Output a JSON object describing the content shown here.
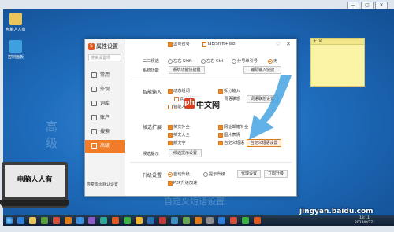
{
  "vm": {
    "title_buttons": [
      "—",
      "▢",
      "✕"
    ]
  },
  "desktop": {
    "icons": [
      {
        "label": "电脑人人有",
        "color": "#e8c45a"
      },
      {
        "label": "控制面板",
        "color": "#3fa0e0"
      }
    ],
    "watermark_big": [
      "高",
      "级"
    ],
    "watermark_bottom": "自定义短语设置",
    "laptop_label": "电脑人人有",
    "sticky_controls": "+ ✕"
  },
  "dialog": {
    "title": "属性设置",
    "search_placeholder": "搜索设置项",
    "win_buttons": {
      "skin": "♡",
      "close": "✕"
    },
    "nav": [
      {
        "label": "常用",
        "active": false
      },
      {
        "label": "外观",
        "active": false
      },
      {
        "label": "词库",
        "active": false
      },
      {
        "label": "账户",
        "active": false
      },
      {
        "label": "搜索",
        "active": false
      },
      {
        "label": "高级",
        "active": true
      }
    ],
    "restore_default": "恢复本页默认设置",
    "top_rows": {
      "row1": {
        "opt1": "逗号句号",
        "opt2": "Tab/Shift+Tab"
      },
      "row2": {
        "label": "二三候选",
        "opt1": "左右 Shift",
        "opt2": "左右 Ctrl",
        "opt3": "分号单引号",
        "opt4": "无"
      },
      "row3": {
        "label": "系统功能",
        "btn1": "系统功能快捷键",
        "btn2": "辅助输入快捷"
      }
    },
    "sections": {
      "fuzzy": {
        "title": "智能输入",
        "items": [
          "动态组词",
          "云计算算法",
          "智能人名",
          "拆分输入",
          "词语联想"
        ],
        "button": "词语联想设置"
      },
      "candidate": {
        "title": "候选扩展",
        "items": [
          "英文补全",
          "网址邮箱补全",
          "英文大全",
          "图片表情",
          "颜文字",
          "自定义短语"
        ],
        "button": "自定义短语设置",
        "row_label": "候选提示",
        "row_button": "候选提示设置"
      },
      "upgrade": {
        "title": "升级设置",
        "opt1": "自动升级",
        "opt2": "提示升级",
        "btn1": "代理设置",
        "btn2": "立即升级",
        "p2p": "P2P升级加速"
      }
    }
  },
  "php_logo": {
    "mark": "php",
    "text": "中文网",
    "sub": "php.cn"
  },
  "taskbar": {
    "clock": "2019/8/27",
    "right_time": "18:11"
  },
  "footer": {
    "site": "jingyan.baidu.com"
  }
}
